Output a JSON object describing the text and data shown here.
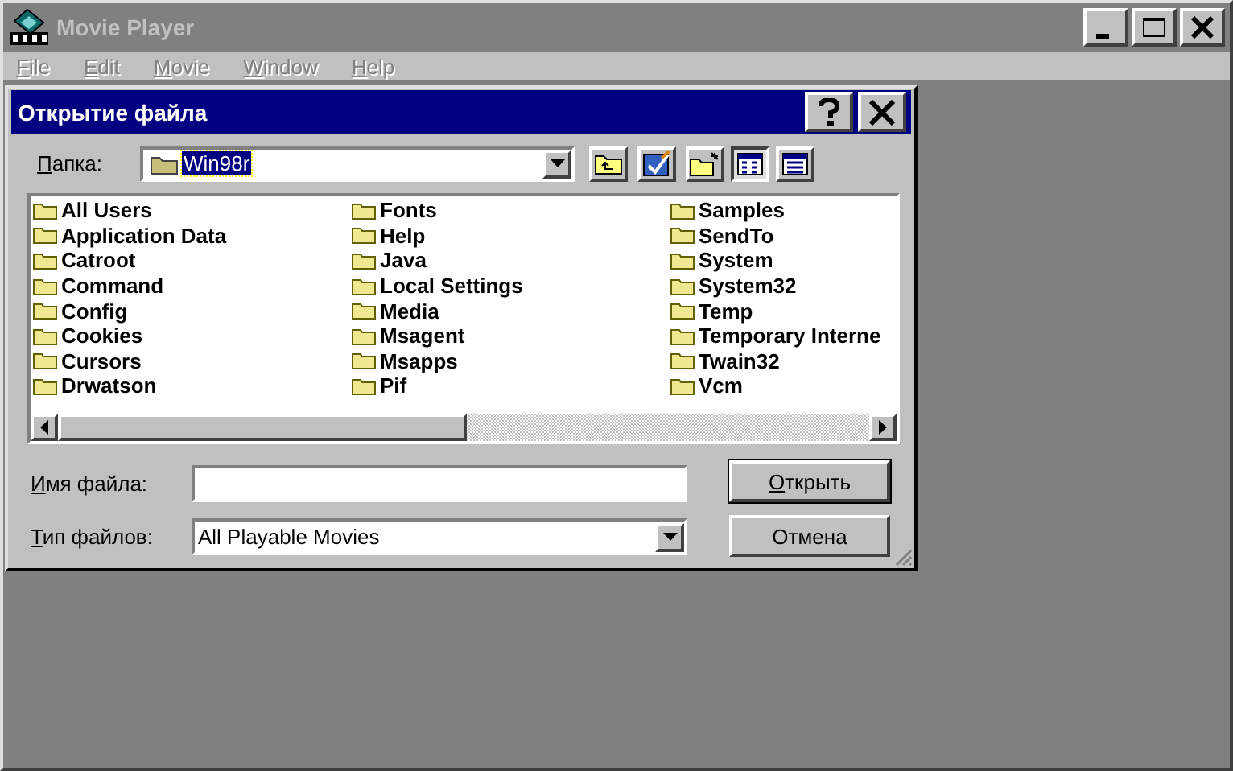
{
  "window": {
    "title": "Movie Player",
    "active": false
  },
  "menu": [
    {
      "label": "File",
      "disabled": true
    },
    {
      "label": "Edit",
      "disabled": true
    },
    {
      "label": "Movie",
      "disabled": true
    },
    {
      "label": "Window",
      "disabled": true
    },
    {
      "label": "Help",
      "disabled": true
    }
  ],
  "dialog": {
    "title": "Открытие файла",
    "folder_label": "Папка:",
    "folder": "Win98r",
    "view_buttons": [
      {
        "kind": "list",
        "selected": true
      },
      {
        "kind": "details",
        "selected": false
      }
    ],
    "columns": [
      [
        "All Users",
        "Application Data",
        "Catroot",
        "Command",
        "Config",
        "Cookies",
        "Cursors",
        "Drwatson"
      ],
      [
        "Fonts",
        "Help",
        "Java",
        "Local Settings",
        "Media",
        "Msagent",
        "Msapps",
        "Pif"
      ],
      [
        "Samples",
        "SendTo",
        "System",
        "System32",
        "Temp",
        "Temporary Interne",
        "Twain32",
        "Vcm"
      ]
    ],
    "filename_label": "Имя файла:",
    "filetype_label": "Тип файлов:",
    "filetype": "All Playable Movies",
    "buttons": [
      {
        "label": "Открыть",
        "default": true
      },
      {
        "label": "Отмена",
        "default": false
      }
    ]
  }
}
